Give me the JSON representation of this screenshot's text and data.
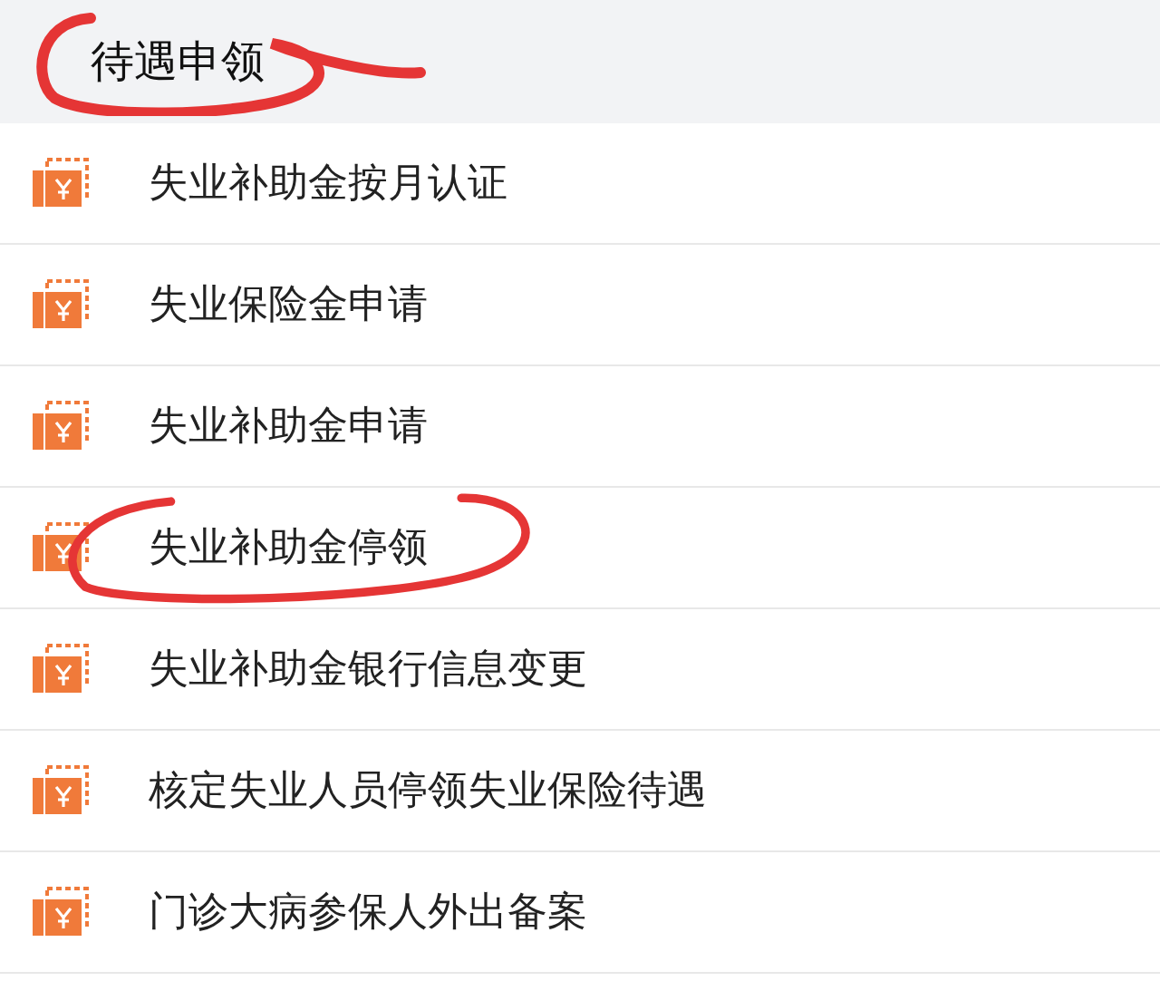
{
  "header": {
    "title": "待遇申领",
    "circled": true
  },
  "items": [
    {
      "label": "失业补助金按月认证",
      "circled": false
    },
    {
      "label": "失业保险金申请",
      "circled": false
    },
    {
      "label": "失业补助金申请",
      "circled": false
    },
    {
      "label": "失业补助金停领",
      "circled": true
    },
    {
      "label": "失业补助金银行信息变更",
      "circled": false
    },
    {
      "label": "核定失业人员停领失业保险待遇",
      "circled": false
    },
    {
      "label": "门诊大病参保人外出备案",
      "circled": false
    }
  ]
}
